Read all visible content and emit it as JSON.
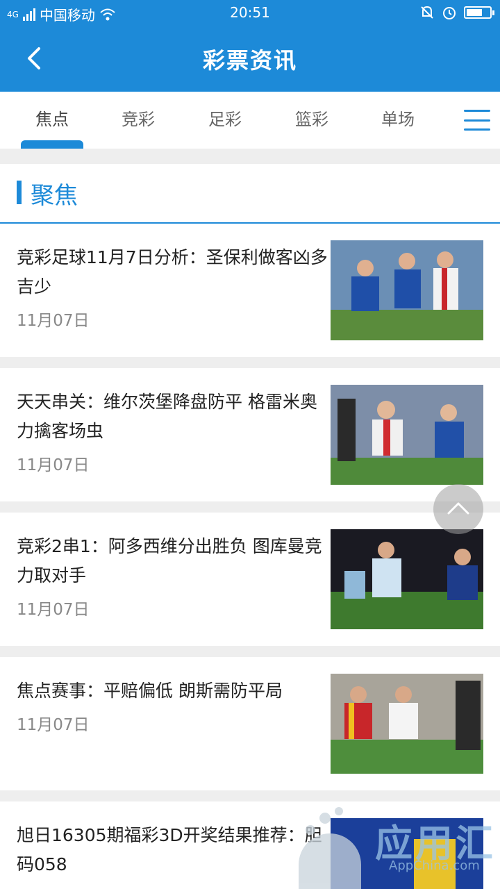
{
  "status_bar": {
    "network": "4G",
    "carrier": "中国移动",
    "time": "20:51"
  },
  "app_bar": {
    "title": "彩票资讯"
  },
  "tabs": [
    {
      "label": "焦点",
      "active": true
    },
    {
      "label": "竞彩",
      "active": false
    },
    {
      "label": "足彩",
      "active": false
    },
    {
      "label": "篮彩",
      "active": false
    },
    {
      "label": "单场",
      "active": false
    }
  ],
  "section": {
    "title": "聚焦"
  },
  "news": [
    {
      "title": "竞彩足球11月7日分析：圣保利做客凶多吉少",
      "date": "11月07日"
    },
    {
      "title": "天天串关：维尔茨堡降盘防平 格雷米奥力擒客场虫",
      "date": "11月07日"
    },
    {
      "title": "竞彩2串1：阿多西维分出胜负 图库曼竞力取对手",
      "date": "11月07日"
    },
    {
      "title": "焦点赛事：平赔偏低 朗斯需防平局",
      "date": "11月07日"
    },
    {
      "title": "旭日16305期福彩3D开奖结果推荐：胆码058",
      "date": ""
    }
  ],
  "watermark": {
    "text": "应用汇",
    "sub": "AppChina.com"
  },
  "colors": {
    "brand": "#1d8ad8",
    "page_bg": "#eeeeee"
  }
}
